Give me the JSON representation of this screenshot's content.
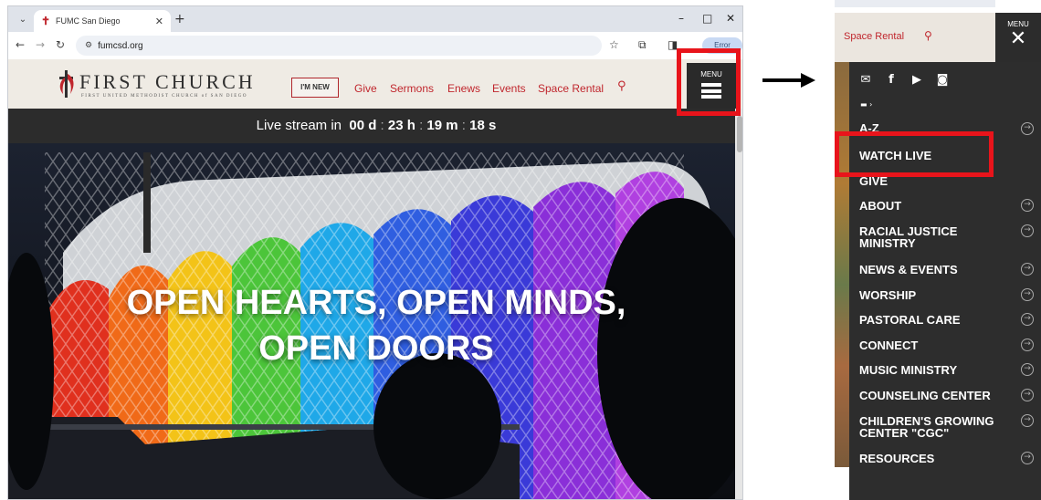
{
  "browser": {
    "tab_title": "FUMC San Diego",
    "url": "fumcsd.org",
    "profile_label": "Error"
  },
  "site": {
    "logo_main": "FIRST CHURCH",
    "logo_sub": "FIRST UNITED METHODIST CHURCH of SAN DIEGO",
    "im_new": "I'M NEW",
    "nav": [
      "Give",
      "Sermons",
      "Enews",
      "Events",
      "Space Rental"
    ],
    "menu_label": "MENU",
    "livestream": {
      "prefix": "Live stream in",
      "days": "00 d",
      "hours": "23 h",
      "minutes": "19 m",
      "seconds": "18 s"
    },
    "hero_line1": "OPEN HEARTS, OPEN MINDS,",
    "hero_line2": "OPEN DOORS"
  },
  "menu_panel": {
    "space_rental": "Space Rental",
    "menu_label": "MENU",
    "items": [
      {
        "label": "A-Z",
        "arrow": true
      },
      {
        "label": "WATCH LIVE",
        "arrow": false
      },
      {
        "label": "GIVE",
        "arrow": false
      },
      {
        "label": "ABOUT",
        "arrow": true
      },
      {
        "label": "RACIAL JUSTICE",
        "label2": "MINISTRY",
        "arrow": true
      },
      {
        "label": "NEWS & EVENTS",
        "arrow": true
      },
      {
        "label": "WORSHIP",
        "arrow": true
      },
      {
        "label": "PASTORAL CARE",
        "arrow": true
      },
      {
        "label": "CONNECT",
        "arrow": true
      },
      {
        "label": "MUSIC MINISTRY",
        "arrow": true
      },
      {
        "label": "COUNSELING CENTER",
        "arrow": true
      },
      {
        "label": "CHILDREN'S GROWING",
        "label2": "CENTER \"CGC\"",
        "arrow": true
      },
      {
        "label": "RESOURCES",
        "arrow": true
      }
    ]
  },
  "colors": {
    "accent": "#c0262d",
    "highlight": "#e8141b",
    "header_bg": "#efebe4",
    "dark_bg": "#2d2d2d"
  }
}
